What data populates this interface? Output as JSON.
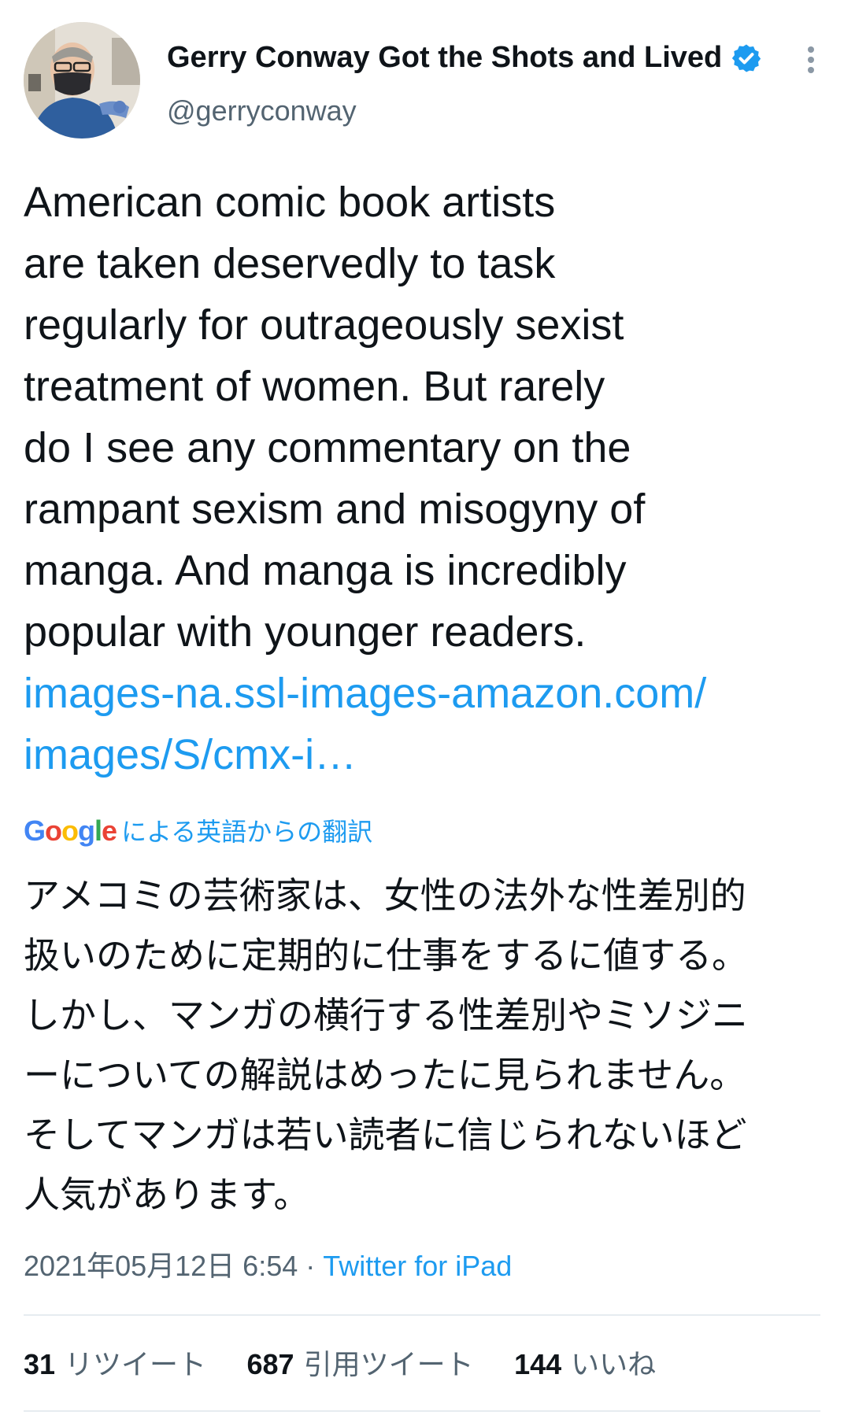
{
  "author": {
    "name": "Gerry Conway Got the Shots and Lived",
    "handle": "@gerryconway",
    "verified_color": "#1d9bf0"
  },
  "icons": {
    "verified": "verified-badge-icon",
    "more": "more-options-icon"
  },
  "tweet": {
    "text_lines": [
      "American comic book artists",
      "are taken deservedly to task",
      "regularly for outrageously sexist",
      "treatment of women. But rarely",
      "do I see any commentary on the",
      "rampant sexism and misogyny of",
      "manga. And manga is incredibly",
      "popular with younger readers."
    ],
    "link_lines": [
      "images-na.ssl-images-amazon.com/",
      "images/S/cmx-i…"
    ]
  },
  "translation": {
    "provider_letters": [
      "G",
      "o",
      "o",
      "g",
      "l",
      "e"
    ],
    "label": "による英語からの翻訳",
    "lines": [
      "アメコミの芸術家は、女性の法外な性差別的",
      "扱いのために定期的に仕事をするに値する。",
      "しかし、マンガの横行する性差別やミソジニ",
      "ーについての解説はめったに見られません。",
      "そしてマンガは若い読者に信じられないほど",
      "人気があります。"
    ]
  },
  "meta": {
    "timestamp": "2021年05月12日 6:54",
    "separator": " · ",
    "source": "Twitter for iPad"
  },
  "stats": {
    "retweets": {
      "count": "31",
      "label": "リツイート"
    },
    "quotes": {
      "count": "687",
      "label": "引用ツイート"
    },
    "likes": {
      "count": "144",
      "label": "いいね"
    }
  },
  "colors": {
    "link": "#1d9bf0",
    "secondary_text": "#536471",
    "primary_text": "#0f1419"
  }
}
